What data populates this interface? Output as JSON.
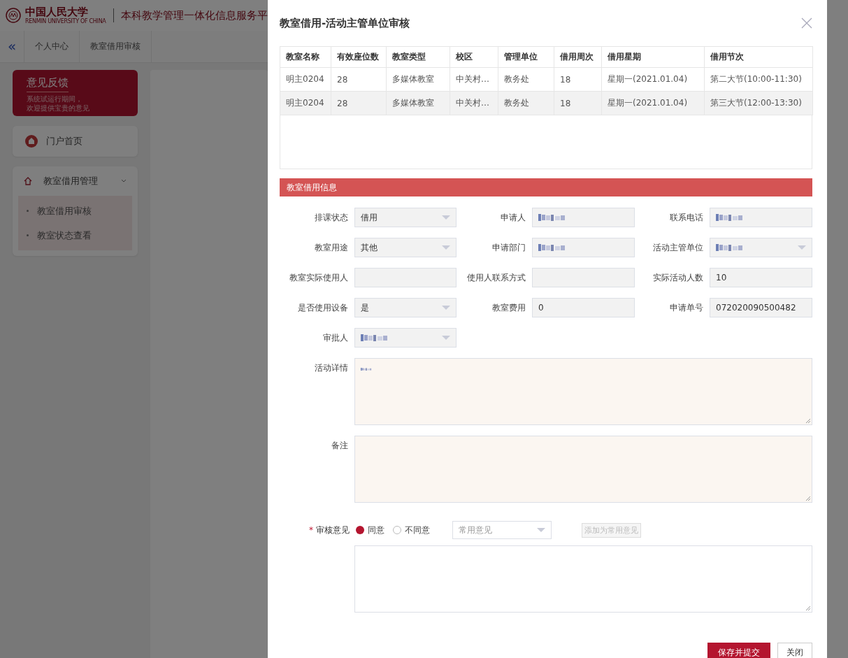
{
  "header": {
    "logo_cn": "中国人民大学",
    "logo_en": "RENMIN UNIVERSITY OF CHINA",
    "title": "本科教学管理一体化信息服务平"
  },
  "nav": {
    "collapse": "«",
    "tabs": [
      "个人中心",
      "教室借用审核"
    ]
  },
  "feedback": {
    "title": "意见反馈",
    "lines": [
      "系统试运行期间，",
      "欢迎提供宝贵的意见"
    ]
  },
  "sidebar": {
    "home": "门户首页",
    "groups": [
      {
        "label": "教室借用管理",
        "expanded": true,
        "children": [
          {
            "label": "教室借用审核"
          },
          {
            "label": "教室状态查看"
          }
        ]
      }
    ]
  },
  "dialog": {
    "title": "教室借用-活动主管单位审核",
    "table": {
      "columns": [
        "教室名称",
        "有效座位数",
        "教室类型",
        "校区",
        "管理单位",
        "借用周次",
        "借用星期",
        "借用节次"
      ],
      "rows": [
        [
          "明主0204",
          "28",
          "多媒体教室",
          "中关村…",
          "教务处",
          "18",
          "星期一(2021.01.04)",
          "第二大节(10:00-11:30)"
        ],
        [
          "明主0204",
          "28",
          "多媒体教室",
          "中关村…",
          "教务处",
          "18",
          "星期一(2021.01.04)",
          "第三大节(12:00-13:30)"
        ]
      ]
    },
    "section": "教室借用信息",
    "fields": [
      {
        "label": "排课状态",
        "kind": "select",
        "value": "借用"
      },
      {
        "label": "申请人",
        "kind": "input",
        "redacted": true
      },
      {
        "label": "联系电话",
        "kind": "input",
        "redacted": true
      },
      {
        "label": "教室用途",
        "kind": "select",
        "value": "其他"
      },
      {
        "label": "申请部门",
        "kind": "input",
        "redacted": true
      },
      {
        "label": "活动主管单位",
        "kind": "select",
        "redacted": true
      },
      {
        "label": "教室实际使用人",
        "kind": "input"
      },
      {
        "label": "使用人联系方式",
        "kind": "input"
      },
      {
        "label": "实际活动人数",
        "kind": "input",
        "value": "10"
      },
      {
        "label": "是否使用设备",
        "kind": "select",
        "value": "是"
      },
      {
        "label": "教室费用",
        "kind": "input",
        "value": "0"
      },
      {
        "label": "申请单号",
        "kind": "input",
        "value": "072020090500482"
      },
      {
        "label": "审批人",
        "kind": "select",
        "redacted": true
      }
    ],
    "textareas": [
      {
        "label": "活动详情",
        "redacted": true
      },
      {
        "label": "备注"
      }
    ],
    "review": {
      "label": "审核意见",
      "required_mark": "*",
      "options": [
        {
          "label": "同意",
          "selected": true
        },
        {
          "label": "不同意",
          "selected": false
        }
      ],
      "preset_placeholder": "常用意见",
      "add_button": {
        "label": "添加为常用意见",
        "disabled": true
      }
    },
    "buttons": [
      {
        "label": "保存并提交",
        "kind": "primary"
      },
      {
        "label": "关闭",
        "kind": "plain"
      }
    ]
  }
}
